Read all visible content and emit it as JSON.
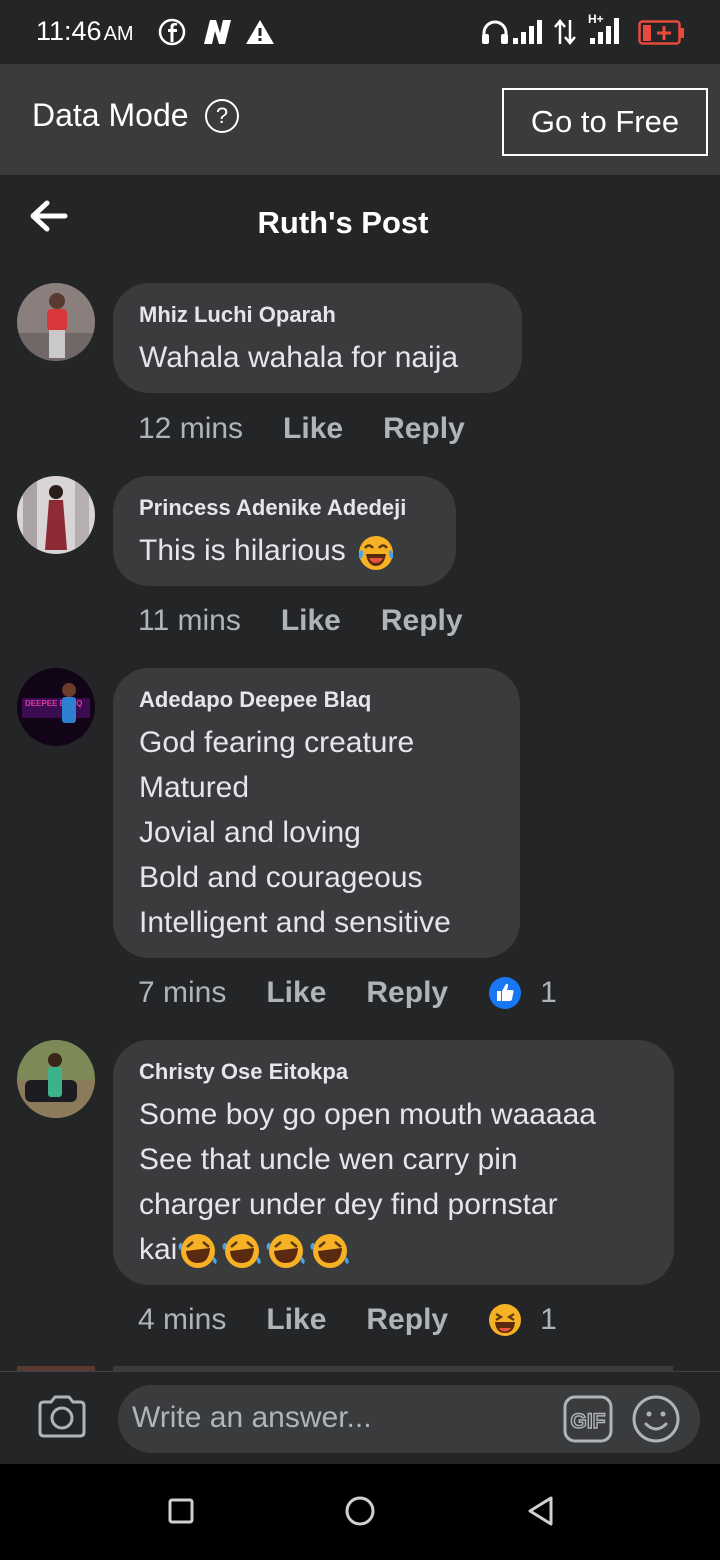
{
  "status_bar": {
    "time": "11:46",
    "ampm": "AM"
  },
  "data_mode": {
    "label": "Data Mode",
    "help_icon": "?",
    "button_label": "Go to Free"
  },
  "header": {
    "title": "Ruth's Post"
  },
  "comments": [
    {
      "author": "Mhiz Luchi Oparah",
      "lines": [
        "Wahala wahala for naija"
      ],
      "time": "12 mins",
      "like": "Like",
      "reply": "Reply"
    },
    {
      "author": "Princess Adenike Adedeji",
      "lines": [
        "This is hilarious"
      ],
      "line_emoji": "laughing-tears",
      "time": "11 mins",
      "like": "Like",
      "reply": "Reply"
    },
    {
      "author": "Adedapo Deepee Blaq",
      "avatar_text": "DEEPEE BLAQ",
      "lines": [
        "God fearing creature",
        "Matured",
        "Jovial and loving",
        "Bold and courageous",
        "Intelligent and sensitive"
      ],
      "time": "7 mins",
      "like": "Like",
      "reply": "Reply",
      "reaction": {
        "type": "like",
        "count": "1"
      }
    },
    {
      "author": "Christy Ose Eitokpa",
      "lines": [
        "Some boy go open mouth waaaaa",
        "See that uncle wen carry pin",
        "charger under dey find pornstar",
        "kai"
      ],
      "line_emoji": "rolling-laughing",
      "time": "4 mins",
      "like": "Like",
      "reply": "Reply",
      "reaction": {
        "type": "haha",
        "count": "1"
      }
    }
  ],
  "composer": {
    "placeholder": "Write an answer...",
    "gif_label": "GIF"
  },
  "colors": {
    "background": "#242526",
    "bubble": "#3a3b3c",
    "text": "#e4e6eb",
    "muted": "#b0b3b8",
    "like_blue": "#1877f2",
    "emoji_yellow": "#f7b125"
  }
}
